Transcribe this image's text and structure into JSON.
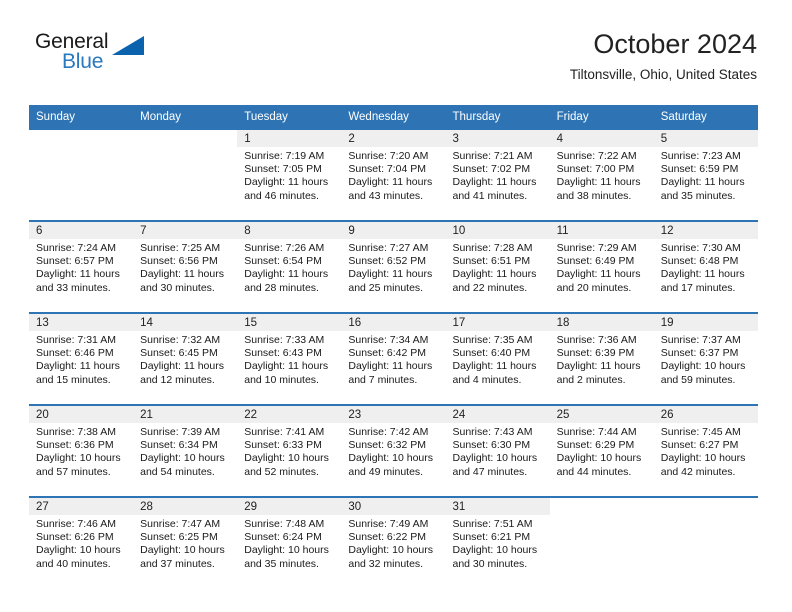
{
  "brand": {
    "name_top": "General",
    "name_bottom": "Blue",
    "accent_color": "#0b63ae",
    "text_color": "#2879bd"
  },
  "header": {
    "title": "October 2024",
    "subtitle": "Tiltonsville, Ohio, United States"
  },
  "theme": {
    "header_blue": "#2e74b5",
    "daynum_bg": "#efefef"
  },
  "weekday_headers": [
    "Sunday",
    "Monday",
    "Tuesday",
    "Wednesday",
    "Thursday",
    "Friday",
    "Saturday"
  ],
  "weeks": [
    [
      {
        "day": "",
        "lines": []
      },
      {
        "day": "",
        "lines": []
      },
      {
        "day": "1",
        "lines": [
          "Sunrise: 7:19 AM",
          "Sunset: 7:05 PM",
          "Daylight: 11 hours",
          "and 46 minutes."
        ]
      },
      {
        "day": "2",
        "lines": [
          "Sunrise: 7:20 AM",
          "Sunset: 7:04 PM",
          "Daylight: 11 hours",
          "and 43 minutes."
        ]
      },
      {
        "day": "3",
        "lines": [
          "Sunrise: 7:21 AM",
          "Sunset: 7:02 PM",
          "Daylight: 11 hours",
          "and 41 minutes."
        ]
      },
      {
        "day": "4",
        "lines": [
          "Sunrise: 7:22 AM",
          "Sunset: 7:00 PM",
          "Daylight: 11 hours",
          "and 38 minutes."
        ]
      },
      {
        "day": "5",
        "lines": [
          "Sunrise: 7:23 AM",
          "Sunset: 6:59 PM",
          "Daylight: 11 hours",
          "and 35 minutes."
        ]
      }
    ],
    [
      {
        "day": "6",
        "lines": [
          "Sunrise: 7:24 AM",
          "Sunset: 6:57 PM",
          "Daylight: 11 hours",
          "and 33 minutes."
        ]
      },
      {
        "day": "7",
        "lines": [
          "Sunrise: 7:25 AM",
          "Sunset: 6:56 PM",
          "Daylight: 11 hours",
          "and 30 minutes."
        ]
      },
      {
        "day": "8",
        "lines": [
          "Sunrise: 7:26 AM",
          "Sunset: 6:54 PM",
          "Daylight: 11 hours",
          "and 28 minutes."
        ]
      },
      {
        "day": "9",
        "lines": [
          "Sunrise: 7:27 AM",
          "Sunset: 6:52 PM",
          "Daylight: 11 hours",
          "and 25 minutes."
        ]
      },
      {
        "day": "10",
        "lines": [
          "Sunrise: 7:28 AM",
          "Sunset: 6:51 PM",
          "Daylight: 11 hours",
          "and 22 minutes."
        ]
      },
      {
        "day": "11",
        "lines": [
          "Sunrise: 7:29 AM",
          "Sunset: 6:49 PM",
          "Daylight: 11 hours",
          "and 20 minutes."
        ]
      },
      {
        "day": "12",
        "lines": [
          "Sunrise: 7:30 AM",
          "Sunset: 6:48 PM",
          "Daylight: 11 hours",
          "and 17 minutes."
        ]
      }
    ],
    [
      {
        "day": "13",
        "lines": [
          "Sunrise: 7:31 AM",
          "Sunset: 6:46 PM",
          "Daylight: 11 hours",
          "and 15 minutes."
        ]
      },
      {
        "day": "14",
        "lines": [
          "Sunrise: 7:32 AM",
          "Sunset: 6:45 PM",
          "Daylight: 11 hours",
          "and 12 minutes."
        ]
      },
      {
        "day": "15",
        "lines": [
          "Sunrise: 7:33 AM",
          "Sunset: 6:43 PM",
          "Daylight: 11 hours",
          "and 10 minutes."
        ]
      },
      {
        "day": "16",
        "lines": [
          "Sunrise: 7:34 AM",
          "Sunset: 6:42 PM",
          "Daylight: 11 hours",
          "and 7 minutes."
        ]
      },
      {
        "day": "17",
        "lines": [
          "Sunrise: 7:35 AM",
          "Sunset: 6:40 PM",
          "Daylight: 11 hours",
          "and 4 minutes."
        ]
      },
      {
        "day": "18",
        "lines": [
          "Sunrise: 7:36 AM",
          "Sunset: 6:39 PM",
          "Daylight: 11 hours",
          "and 2 minutes."
        ]
      },
      {
        "day": "19",
        "lines": [
          "Sunrise: 7:37 AM",
          "Sunset: 6:37 PM",
          "Daylight: 10 hours",
          "and 59 minutes."
        ]
      }
    ],
    [
      {
        "day": "20",
        "lines": [
          "Sunrise: 7:38 AM",
          "Sunset: 6:36 PM",
          "Daylight: 10 hours",
          "and 57 minutes."
        ]
      },
      {
        "day": "21",
        "lines": [
          "Sunrise: 7:39 AM",
          "Sunset: 6:34 PM",
          "Daylight: 10 hours",
          "and 54 minutes."
        ]
      },
      {
        "day": "22",
        "lines": [
          "Sunrise: 7:41 AM",
          "Sunset: 6:33 PM",
          "Daylight: 10 hours",
          "and 52 minutes."
        ]
      },
      {
        "day": "23",
        "lines": [
          "Sunrise: 7:42 AM",
          "Sunset: 6:32 PM",
          "Daylight: 10 hours",
          "and 49 minutes."
        ]
      },
      {
        "day": "24",
        "lines": [
          "Sunrise: 7:43 AM",
          "Sunset: 6:30 PM",
          "Daylight: 10 hours",
          "and 47 minutes."
        ]
      },
      {
        "day": "25",
        "lines": [
          "Sunrise: 7:44 AM",
          "Sunset: 6:29 PM",
          "Daylight: 10 hours",
          "and 44 minutes."
        ]
      },
      {
        "day": "26",
        "lines": [
          "Sunrise: 7:45 AM",
          "Sunset: 6:27 PM",
          "Daylight: 10 hours",
          "and 42 minutes."
        ]
      }
    ],
    [
      {
        "day": "27",
        "lines": [
          "Sunrise: 7:46 AM",
          "Sunset: 6:26 PM",
          "Daylight: 10 hours",
          "and 40 minutes."
        ]
      },
      {
        "day": "28",
        "lines": [
          "Sunrise: 7:47 AM",
          "Sunset: 6:25 PM",
          "Daylight: 10 hours",
          "and 37 minutes."
        ]
      },
      {
        "day": "29",
        "lines": [
          "Sunrise: 7:48 AM",
          "Sunset: 6:24 PM",
          "Daylight: 10 hours",
          "and 35 minutes."
        ]
      },
      {
        "day": "30",
        "lines": [
          "Sunrise: 7:49 AM",
          "Sunset: 6:22 PM",
          "Daylight: 10 hours",
          "and 32 minutes."
        ]
      },
      {
        "day": "31",
        "lines": [
          "Sunrise: 7:51 AM",
          "Sunset: 6:21 PM",
          "Daylight: 10 hours",
          "and 30 minutes."
        ]
      },
      {
        "day": "",
        "lines": []
      },
      {
        "day": "",
        "lines": []
      }
    ]
  ]
}
